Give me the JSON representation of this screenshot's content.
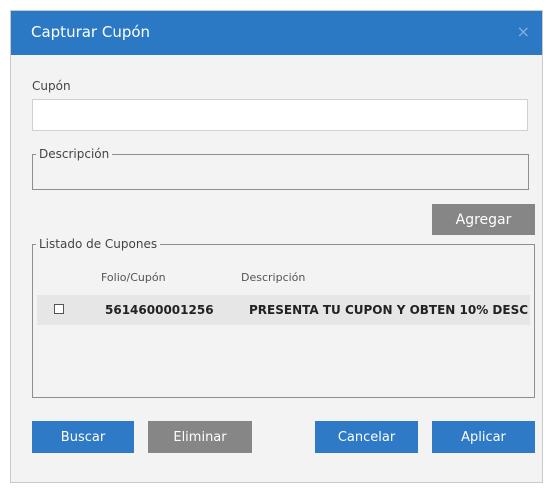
{
  "dialog": {
    "title": "Capturar Cupón",
    "close_icon": "×"
  },
  "coupon": {
    "label": "Cupón",
    "value": ""
  },
  "description": {
    "legend": "Descripción",
    "value": ""
  },
  "buttons": {
    "add": "Agregar",
    "search": "Buscar",
    "delete": "Eliminar",
    "cancel": "Cancelar",
    "apply": "Aplicar"
  },
  "coupon_list": {
    "legend": "Listado de Cupones",
    "columns": [
      "Folio/Cupón",
      "Descripción"
    ],
    "rows": [
      {
        "checked": false,
        "folio": "5614600001256",
        "description": "PRESENTA TU CUPON Y OBTEN 10% DESC"
      }
    ]
  },
  "colors": {
    "titlebar": "#2b79c4",
    "primary_button": "#2e7ac6",
    "secondary_button": "#868686",
    "dialog_background": "#f3f3f3"
  }
}
